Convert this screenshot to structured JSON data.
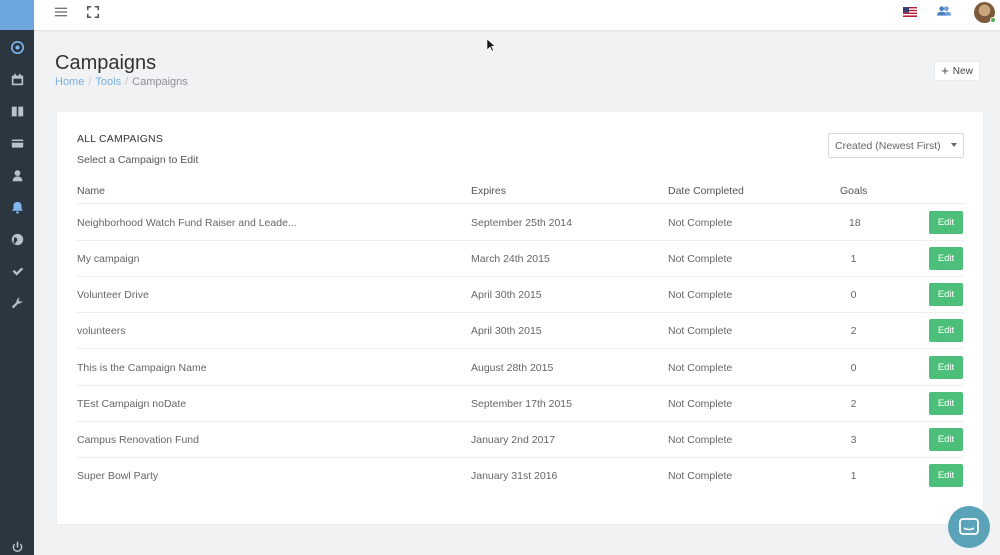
{
  "sidebar": {
    "items": [
      {
        "icon": "dashboard-icon"
      },
      {
        "icon": "calendar-icon"
      },
      {
        "icon": "book-icon"
      },
      {
        "icon": "credit-card-icon"
      },
      {
        "icon": "user-icon"
      },
      {
        "icon": "bell-icon"
      },
      {
        "icon": "globe-icon"
      },
      {
        "icon": "check-icon"
      },
      {
        "icon": "wrench-icon"
      },
      {
        "icon": "power-icon"
      }
    ]
  },
  "page": {
    "title": "Campaigns",
    "breadcrumb": {
      "home": "Home",
      "tools": "Tools",
      "current": "Campaigns"
    },
    "new_label": "New"
  },
  "card": {
    "title": "ALL CAMPAIGNS",
    "subtitle": "Select a Campaign to Edit",
    "sort_value": "Created (Newest First)"
  },
  "table": {
    "headers": {
      "name": "Name",
      "expires": "Expires",
      "date_completed": "Date Completed",
      "goals": "Goals"
    },
    "edit_label": "Edit",
    "rows": [
      {
        "name": "Neighborhood Watch Fund Raiser and Leade...",
        "expires": "September 25th 2014",
        "completed": "Not Complete",
        "goals": "18"
      },
      {
        "name": "My campaign",
        "expires": "March 24th 2015",
        "completed": "Not Complete",
        "goals": "1"
      },
      {
        "name": "Volunteer Drive",
        "expires": "April 30th 2015",
        "completed": "Not Complete",
        "goals": "0"
      },
      {
        "name": "volunteers",
        "expires": "April 30th 2015",
        "completed": "Not Complete",
        "goals": "2"
      },
      {
        "name": "This is the Campaign Name",
        "expires": "August 28th 2015",
        "completed": "Not Complete",
        "goals": "0"
      },
      {
        "name": "TEst Campaign noDate",
        "expires": "September 17th 2015",
        "completed": "Not Complete",
        "goals": "2"
      },
      {
        "name": "Campus Renovation Fund",
        "expires": "January 2nd 2017",
        "completed": "Not Complete",
        "goals": "3"
      },
      {
        "name": "Super Bowl Party",
        "expires": "January 31st 2016",
        "completed": "Not Complete",
        "goals": "1"
      }
    ]
  },
  "colors": {
    "edit_button": "#4cc07a",
    "sidebar_bg": "#2b3641",
    "link": "#7ab0e0",
    "chat": "#5aa3b8"
  }
}
